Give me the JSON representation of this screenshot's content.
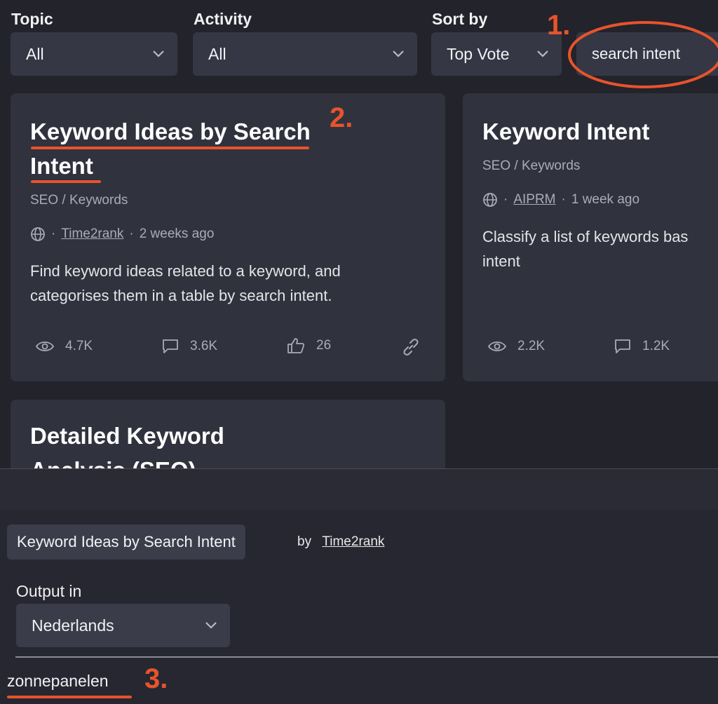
{
  "filters": {
    "topic": {
      "label": "Topic",
      "value": "All"
    },
    "activity": {
      "label": "Activity",
      "value": "All"
    },
    "sort": {
      "label": "Sort by",
      "value": "Top Vote"
    },
    "search": {
      "value": "search intent"
    }
  },
  "annotations": [
    "1.",
    "2.",
    "3."
  ],
  "cards": [
    {
      "title_line1": "Keyword Ideas by Search",
      "title_line2": "Intent",
      "category": "SEO / Keywords",
      "author": "Time2rank",
      "time": "2 weeks ago",
      "desc_line1": "Find keyword ideas related to a keyword, and",
      "desc_line2": "categorises them in a table by search intent.",
      "views": "4.7K",
      "comments": "3.6K",
      "likes": "26"
    },
    {
      "title_line1": "Keyword Intent",
      "category": "SEO / Keywords",
      "author": "AIPRM",
      "time": "1 week ago",
      "desc_line1": "Classify a list of keywords bas",
      "desc_line2": "intent",
      "views": "2.2K",
      "comments": "1.2K"
    },
    {
      "title_line1": "Detailed Keyword",
      "title_line2": "Analysis (SEO)"
    }
  ],
  "prompt_panel": {
    "selected_prompt": "Keyword Ideas by Search Intent",
    "by_label": "by",
    "author": "Time2rank",
    "output_label": "Output in",
    "output_value": "Nederlands",
    "input_value": "zonnepanelen"
  },
  "colors": {
    "background": "#22232b",
    "card": "#30323d",
    "accent_annotation": "#e8532c"
  }
}
